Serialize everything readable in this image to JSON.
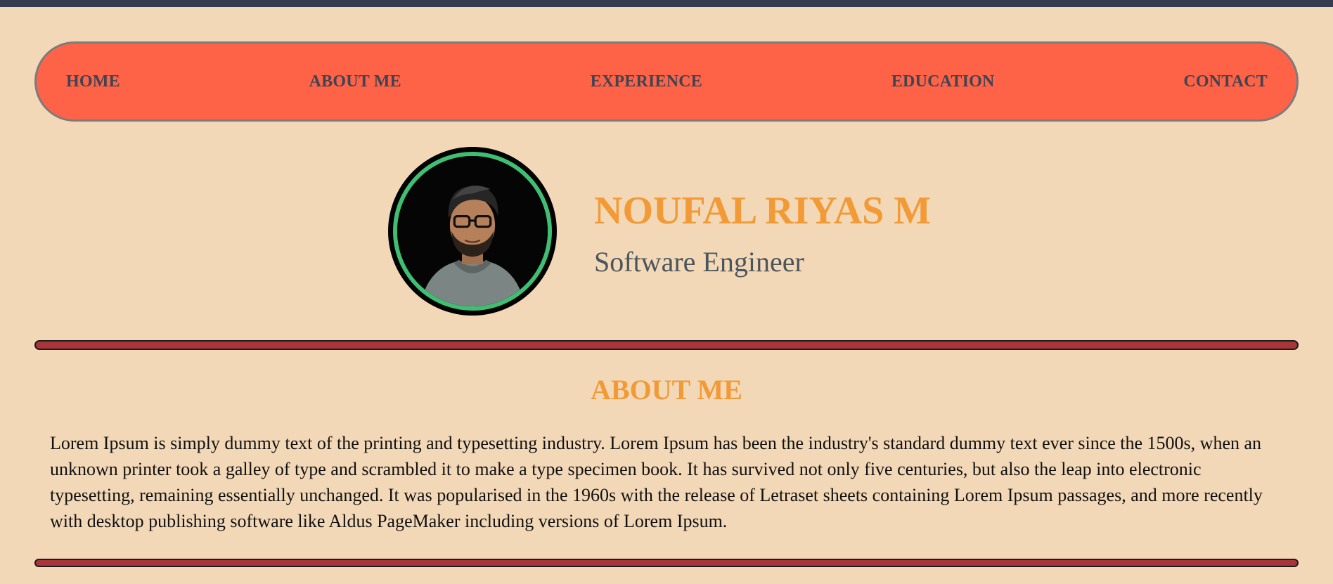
{
  "nav": {
    "items": [
      {
        "label": "HOME"
      },
      {
        "label": "ABOUT ME"
      },
      {
        "label": "EXPERIENCE"
      },
      {
        "label": "EDUCATION"
      },
      {
        "label": "CONTACT"
      }
    ]
  },
  "profile": {
    "name": "NOUFAL RIYAS M",
    "title": "Software Engineer",
    "avatar_icon": "profile-photo"
  },
  "about": {
    "heading": "ABOUT ME",
    "text": "Lorem Ipsum is simply dummy text of the printing and typesetting industry. Lorem Ipsum has been the industry's standard dummy text ever since the 1500s, when an unknown printer took a galley of type and scrambled it to make a type specimen book. It has survived not only five centuries, but also the leap into electronic typesetting, remaining essentially unchanged. It was popularised in the 1960s with the release of Letraset sheets containing Lorem Ipsum passages, and more recently with desktop publishing software like Aldus PageMaker including versions of Lorem Ipsum."
  },
  "colors": {
    "background": "#f3d8b8",
    "top_bar": "#363c4f",
    "nav_background": "#ff6347",
    "nav_text": "#3e4452",
    "accent_orange": "#f29a36",
    "avatar_ring": "#3fbe74",
    "divider": "#a8353a",
    "subtitle": "#4a555c"
  }
}
